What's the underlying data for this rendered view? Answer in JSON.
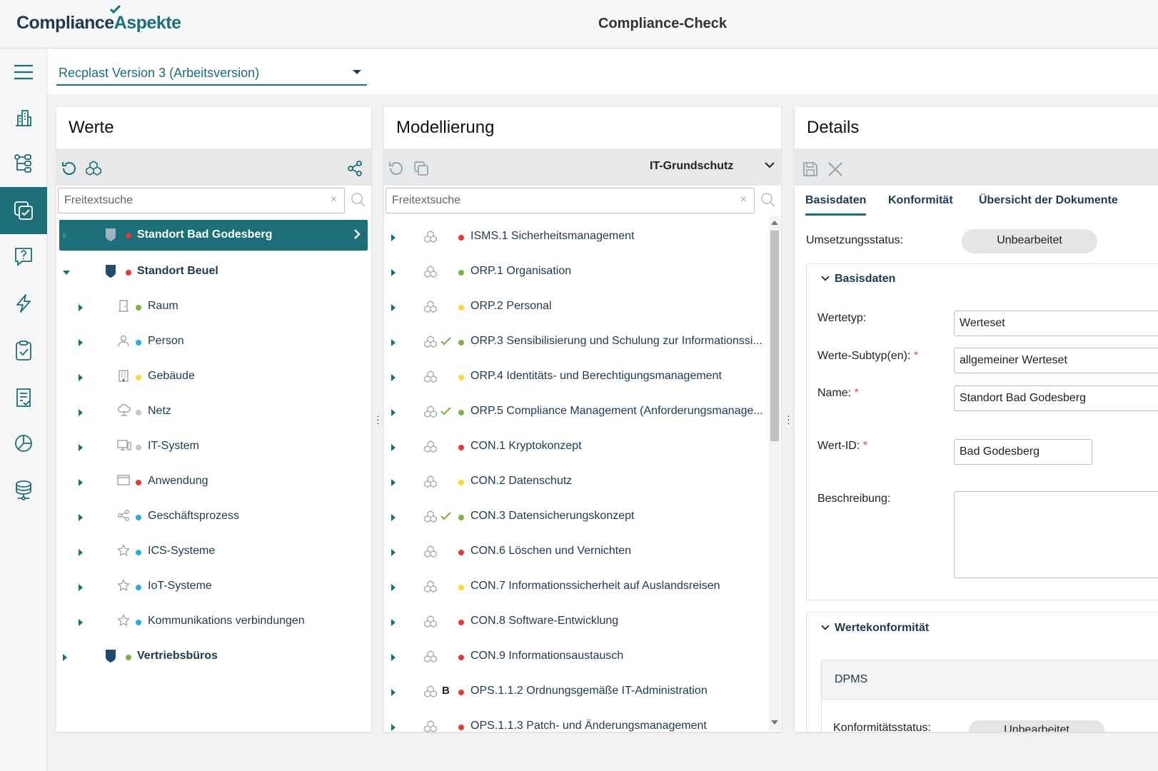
{
  "header": {
    "logo_part1": "Compliance",
    "logo_part2": "Aspekte",
    "app_title": "Compliance-Check"
  },
  "version_select": {
    "value": "Recplast Version 3 (Arbeitsversion)"
  },
  "colors": {
    "accent": "#1c6e78",
    "red": "#e53935",
    "green": "#7cb342",
    "yellow": "#fdd835",
    "blue": "#29a9e1",
    "grey": "#c7c7c7"
  },
  "sidebar": {
    "items": [
      {
        "icon": "menu-icon"
      },
      {
        "icon": "building-icon"
      },
      {
        "icon": "tree-structure-icon"
      },
      {
        "icon": "compliance-check-icon",
        "active": true
      },
      {
        "icon": "question-icon"
      },
      {
        "icon": "lightning-icon"
      },
      {
        "icon": "clipboard-check-icon"
      },
      {
        "icon": "document-check-icon"
      },
      {
        "icon": "pie-chart-icon"
      },
      {
        "icon": "database-icon"
      }
    ]
  },
  "werte": {
    "title": "Werte",
    "search_placeholder": "Freitextsuche",
    "items": [
      {
        "label": "Standort Bad Godesberg",
        "dot": "red",
        "bold": true,
        "selected": true,
        "icon": "shield-icon",
        "level": 0
      },
      {
        "label": "Standort Beuel",
        "dot": "red",
        "bold": true,
        "expanded": true,
        "icon": "shield-icon",
        "level": 0
      },
      {
        "label": "Raum",
        "dot": "green",
        "icon": "door-icon",
        "level": 1
      },
      {
        "label": "Person",
        "dot": "blue",
        "icon": "person-icon",
        "level": 1
      },
      {
        "label": "Gebäude",
        "dot": "yellow",
        "icon": "building-icon",
        "level": 1
      },
      {
        "label": "Netz",
        "dot": "grey",
        "icon": "cloud-network-icon",
        "level": 1
      },
      {
        "label": "IT-System",
        "dot": "grey",
        "icon": "computer-icon",
        "level": 1
      },
      {
        "label": "Anwendung",
        "dot": "red",
        "icon": "window-icon",
        "level": 1
      },
      {
        "label": "Geschäftsprozess",
        "dot": "blue",
        "icon": "share-icon",
        "level": 1
      },
      {
        "label": "ICS-Systeme",
        "dot": "blue",
        "icon": "star-icon",
        "level": 1
      },
      {
        "label": "IoT-Systeme",
        "dot": "blue",
        "icon": "star-icon",
        "level": 1
      },
      {
        "label": "Kommunikations verbindungen",
        "dot": "blue",
        "icon": "star-icon",
        "level": 1
      },
      {
        "label": "Vertriebsbüros",
        "dot": "green",
        "bold": true,
        "icon": "shield-icon",
        "level": 0
      }
    ]
  },
  "modellierung": {
    "title": "Modellierung",
    "framework": "IT-Grundschutz",
    "search_placeholder": "Freitextsuche",
    "items": [
      {
        "label": "ISMS.1 Sicherheitsmanagement",
        "dot": "red",
        "mark": ""
      },
      {
        "label": "ORP.1 Organisation",
        "dot": "green",
        "mark": ""
      },
      {
        "label": "ORP.2 Personal",
        "dot": "yellow",
        "mark": ""
      },
      {
        "label": "ORP.3 Sensibilisierung und Schulung zur Informationssi...",
        "dot": "green",
        "mark": "check"
      },
      {
        "label": "ORP.4 Identitäts- und Berechtigungsmanagement",
        "dot": "yellow",
        "mark": ""
      },
      {
        "label": "ORP.5 Compliance Management (Anforderungsmanage...",
        "dot": "green",
        "mark": "check"
      },
      {
        "label": "CON.1 Kryptokonzept",
        "dot": "red",
        "mark": ""
      },
      {
        "label": "CON.2 Datenschutz",
        "dot": "yellow",
        "mark": ""
      },
      {
        "label": "CON.3 Datensicherungskonzept",
        "dot": "green",
        "mark": "check"
      },
      {
        "label": "CON.6 Löschen und Vernichten",
        "dot": "red",
        "mark": ""
      },
      {
        "label": "CON.7 Informationssicherheit auf Auslandsreisen",
        "dot": "yellow",
        "mark": ""
      },
      {
        "label": "CON.8 Software-Entwicklung",
        "dot": "red",
        "mark": ""
      },
      {
        "label": "CON.9 Informationsaustausch",
        "dot": "red",
        "mark": ""
      },
      {
        "label": "OPS.1.1.2 Ordnungsgemäße IT-Administration",
        "dot": "red",
        "mark": "B"
      },
      {
        "label": "OPS.1.1.3 Patch- und Änderungsmanagement",
        "dot": "red",
        "mark": ""
      }
    ]
  },
  "details": {
    "title": "Details",
    "tabs": [
      "Basisdaten",
      "Konformität",
      "Übersicht der Dokumente"
    ],
    "umsetzungsstatus_label": "Umsetzungsstatus:",
    "umsetzungsstatus_value": "Unbearbeitet",
    "basisdaten_section": "Basisdaten",
    "wertetyp_label": "Wertetyp:",
    "wertetyp_value": "Werteset",
    "subtyp_label": "Werte-Subtyp(en):",
    "subtyp_value": "allgemeiner Werteset",
    "name_label": "Name:",
    "name_value": "Standort Bad Godesberg",
    "wertid_label": "Wert-ID:",
    "wertid_value": "Bad Godesberg",
    "beschreibung_label": "Beschreibung:",
    "beschreibung_value": "",
    "required_mark": "*",
    "wertekonformitaet_section": "Wertekonformität",
    "dpms_label": "DPMS",
    "konformitaetsstatus_label": "Konformitätsstatus:",
    "konformitaetsstatus_value": "Unbearbeitet"
  }
}
